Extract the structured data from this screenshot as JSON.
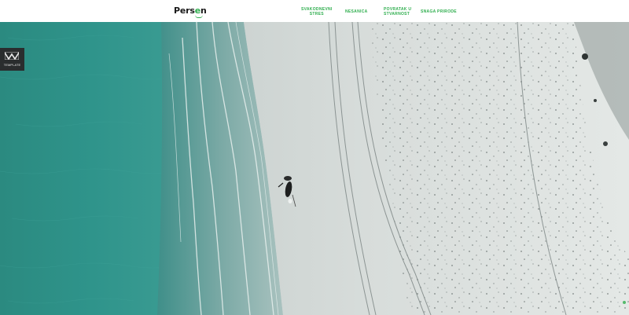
{
  "header": {
    "logo": {
      "prefix": "Pers",
      "accent": "e",
      "suffix": "n"
    },
    "nav": [
      {
        "label": "SVAKODNEVNI\nSTRES"
      },
      {
        "label": "NESANICA"
      },
      {
        "label": "POVRATAK U\nSTVARNOST"
      },
      {
        "label": "SNAGA PRIRODE"
      }
    ]
  },
  "side_badge": {
    "label": "TEMPLATE"
  },
  "hero": {
    "scene": "aerial-beach-rider"
  },
  "colors": {
    "accent": "#2fae4e",
    "header_bg": "#ffffff",
    "badge_bg": "#2a2d2e",
    "sea": "#2f8c84",
    "sand": "#dfe3e1"
  }
}
